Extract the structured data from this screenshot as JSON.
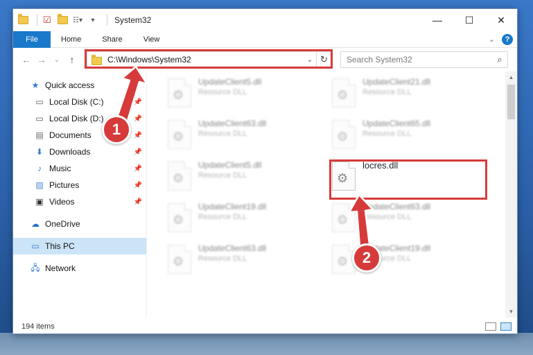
{
  "window": {
    "title": "System32",
    "controls": {
      "minimize": "—",
      "maximize": "☐",
      "close": "✕"
    }
  },
  "ribbon": {
    "tabs": [
      "File",
      "Home",
      "Share",
      "View"
    ],
    "help": "?"
  },
  "address": {
    "path": "C:\\Windows\\System32",
    "search_placeholder": "Search System32"
  },
  "sidebar": {
    "quick_access": "Quick access",
    "pinned": [
      {
        "label": "Local Disk (C:)",
        "icon": "drive-icon"
      },
      {
        "label": "Local Disk (D:)",
        "icon": "drive-icon"
      },
      {
        "label": "Documents",
        "icon": "documents-icon"
      },
      {
        "label": "Downloads",
        "icon": "downloads-icon"
      },
      {
        "label": "Music",
        "icon": "music-icon"
      },
      {
        "label": "Pictures",
        "icon": "pictures-icon"
      },
      {
        "label": "Videos",
        "icon": "videos-icon"
      }
    ],
    "onedrive": "OneDrive",
    "this_pc": "This PC",
    "network": "Network"
  },
  "files": [
    {
      "name": "UpdateClient5.dll",
      "type": "Resource DLL"
    },
    {
      "name": "UpdateClient21.dll",
      "type": "Resource DLL"
    },
    {
      "name": "UpdateClient63.dll",
      "type": "Resource DLL"
    },
    {
      "name": "UpdateClient65.dll",
      "type": "Resource DLL"
    },
    {
      "name": "UpdateClient5.dll",
      "type": "Resource DLL"
    },
    {
      "name": "locres.dll",
      "type": ""
    },
    {
      "name": "UpdateClient19.dll",
      "type": "Resource DLL"
    },
    {
      "name": "UpdateClient63.dll",
      "type": "Resource DLL"
    },
    {
      "name": "UpdateClient63.dll",
      "type": "Resource DLL"
    },
    {
      "name": "UpdateClient19.dll",
      "type": "Resource DLL"
    }
  ],
  "status": {
    "item_count": "194 items"
  },
  "callouts": {
    "one": "1",
    "two": "2"
  },
  "colors": {
    "accent": "#1979ca",
    "highlight": "#d63a3a",
    "selected": "#cce4f7"
  }
}
